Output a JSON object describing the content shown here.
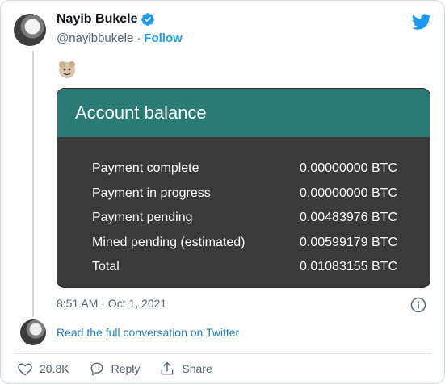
{
  "tweet": {
    "author_name": "Nayib Bukele",
    "handle": "@nayibbukele",
    "separator": "·",
    "follow_label": "Follow",
    "timestamp": "8:51 AM · Oct 1, 2021",
    "read_conversation": "Read the full conversation on Twitter"
  },
  "account_balance": {
    "title": "Account balance",
    "rows": [
      {
        "label": "Payment complete",
        "value": "0.00000000 BTC"
      },
      {
        "label": "Payment in progress",
        "value": "0.00000000 BTC"
      },
      {
        "label": "Payment pending",
        "value": "0.00483976 BTC"
      },
      {
        "label": "Mined pending (estimated)",
        "value": "0.00599179 BTC"
      },
      {
        "label": "Total",
        "value": "0.01083155 BTC"
      }
    ]
  },
  "actions": {
    "likes": "20.8K",
    "reply_label": "Reply",
    "share_label": "Share"
  },
  "colors": {
    "accent": "#1d9bf0",
    "balance_header": "#2a7a75",
    "balance_body": "#3a3a3a"
  },
  "icons": [
    "verified-badge-icon",
    "twitter-bird-icon",
    "emoji-icon",
    "info-icon",
    "heart-icon",
    "reply-icon",
    "share-icon"
  ]
}
